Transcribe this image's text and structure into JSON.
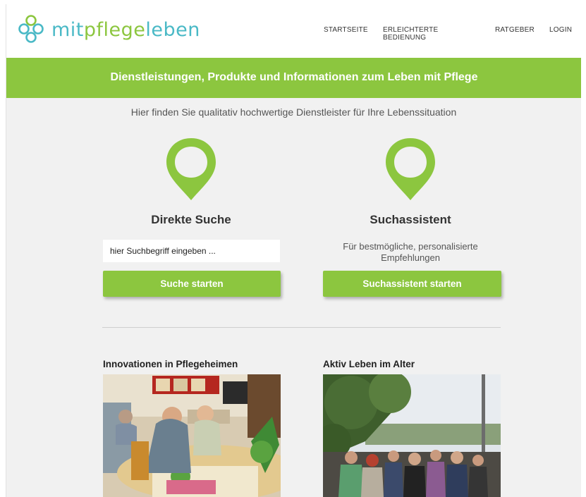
{
  "header": {
    "logo": {
      "part1": "mit",
      "part2": "pflege",
      "part3": "leben"
    },
    "nav": [
      {
        "label": "STARTSEITE"
      },
      {
        "label": "ERLEICHTERTE BEDIENUNG"
      },
      {
        "label": "RATGEBER"
      },
      {
        "label": "LOGIN"
      }
    ]
  },
  "banner": {
    "text": "Dienstleistungen, Produkte und Informationen zum Leben mit Pflege"
  },
  "intro": {
    "text": "Hier finden Sie qualitativ hochwertige Dienstleister für Ihre Lebenssituation"
  },
  "direct_search": {
    "title": "Direkte Suche",
    "placeholder": "hier Suchbegriff eingeben ...",
    "button": "Suche starten",
    "icon": "location-pin-icon"
  },
  "assistant": {
    "title": "Suchassistent",
    "description": "Für bestmögliche, personalisierte Empfehlungen",
    "button": "Suchassistent starten",
    "icon": "location-pin-icon"
  },
  "articles": [
    {
      "title": "Innovationen in Pflegeheimen"
    },
    {
      "title": "Aktiv Leben im Alter"
    }
  ],
  "colors": {
    "brand_green": "#8cc63f",
    "brand_teal": "#4ab9c6",
    "background": "#f1f1f1"
  }
}
